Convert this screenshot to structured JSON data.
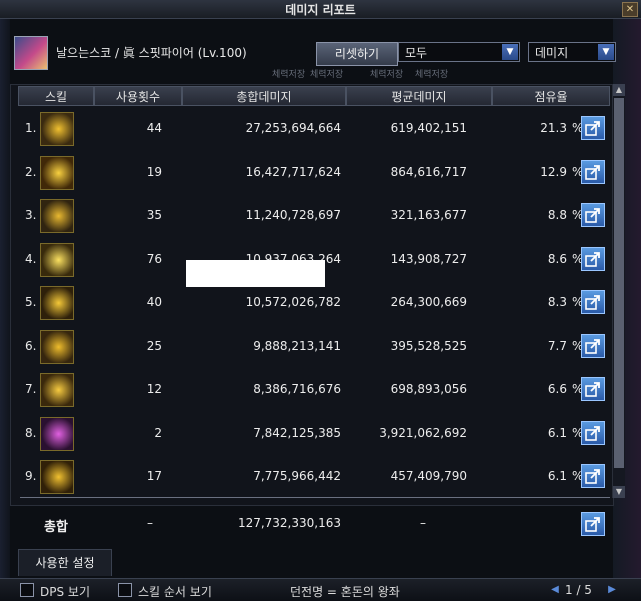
{
  "window": {
    "title": "데미지 리포트"
  },
  "header": {
    "character": "날으는스코 / 眞 스핏파이어 (Lv.100)",
    "reset_label": "리셋하기",
    "filter_value": "모두",
    "sort_value": "데미지",
    "sub_labels": [
      "체력저장",
      "체력저장",
      "체력저장",
      "체력저장"
    ]
  },
  "table": {
    "headers": [
      "스킬",
      "사용횟수",
      "총합데미지",
      "평균데미지",
      "점유율"
    ],
    "percent_symbol": "%",
    "rows": [
      {
        "idx": "1.",
        "uses": "44",
        "total": "27,253,694,664",
        "avg": "619,402,151",
        "share": "21.3",
        "icon_colors": [
          "#3a2a10",
          "#f0c030"
        ]
      },
      {
        "idx": "2.",
        "uses": "19",
        "total": "16,427,717,624",
        "avg": "864,616,717",
        "share": "12.9",
        "icon_colors": [
          "#402808",
          "#f8d040"
        ]
      },
      {
        "idx": "3.",
        "uses": "35",
        "total": "11,240,728,697",
        "avg": "321,163,677",
        "share": "8.8",
        "icon_colors": [
          "#302410",
          "#e8b830"
        ]
      },
      {
        "idx": "4.",
        "uses": "76",
        "total": "10,937,063,264",
        "avg": "143,908,727",
        "share": "8.6",
        "icon_colors": [
          "#382a0c",
          "#fae060"
        ]
      },
      {
        "idx": "5.",
        "uses": "40",
        "total": "10,572,026,782",
        "avg": "264,300,669",
        "share": "8.3",
        "icon_colors": [
          "#2e200a",
          "#f4c838"
        ]
      },
      {
        "idx": "6.",
        "uses": "25",
        "total": "9,888,213,141",
        "avg": "395,528,525",
        "share": "7.7",
        "icon_colors": [
          "#36260e",
          "#eebc2c"
        ]
      },
      {
        "idx": "7.",
        "uses": "12",
        "total": "8,386,716,676",
        "avg": "698,893,056",
        "share": "6.6",
        "icon_colors": [
          "#3a280c",
          "#f6ca40"
        ]
      },
      {
        "idx": "8.",
        "uses": "2",
        "total": "7,842,125,385",
        "avg": "3,921,062,692",
        "share": "6.1",
        "icon_colors": [
          "#2a1030",
          "#e060e0"
        ]
      },
      {
        "idx": "9.",
        "uses": "17",
        "total": "7,775,966,442",
        "avg": "457,409,790",
        "share": "6.1",
        "icon_colors": [
          "#302008",
          "#f0c030"
        ]
      }
    ]
  },
  "totals": {
    "label": "총합",
    "uses": "–",
    "total": "127,732,330,163",
    "avg": "–"
  },
  "tabs": {
    "used_settings": "사용한 설정"
  },
  "bottom": {
    "dps_label": "DPS 보기",
    "skill_order_label": "스킬 순서 보기",
    "dungeon": "던전명 = 혼돈의 왕좌",
    "page": "1 / 5"
  },
  "colors": {
    "accent": "#2a5aa8",
    "icon_border": "#7a6a2a"
  }
}
